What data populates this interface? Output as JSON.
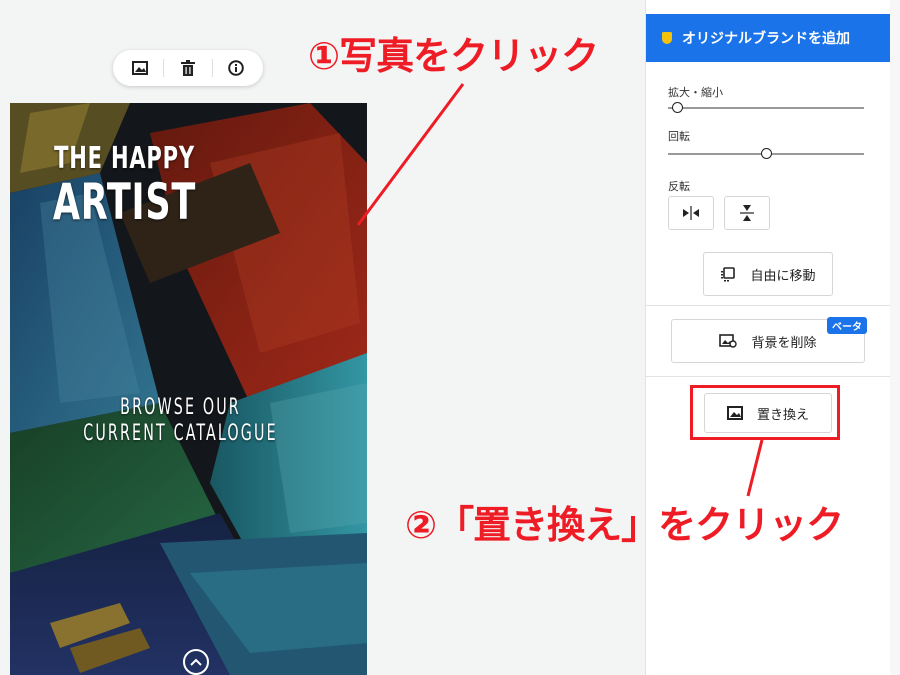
{
  "toolbar": {
    "items": [
      {
        "icon": "image-icon"
      },
      {
        "icon": "trash-icon"
      },
      {
        "icon": "info-icon"
      }
    ]
  },
  "photo": {
    "title_line1": "THE HAPPY",
    "title_line2": "ARTIST",
    "body_line1": "BROWSE OUR",
    "body_line2": "CURRENT CATALOGUE",
    "scroll_icon": "chevron-up-icon"
  },
  "annotations": {
    "step1": "①写真をクリック",
    "step2": "②「置き換え」をクリック",
    "color": "#ee1c25"
  },
  "panel": {
    "brand_button": "オリジナルブランドを追加",
    "zoom_label": "拡大・縮小",
    "zoom_level": 0.02,
    "rotate_label": "回転",
    "rotate_level": 0.5,
    "flip_label": "反転",
    "flip_horizontal_icon": "flip-horizontal-icon",
    "flip_vertical_icon": "flip-vertical-icon",
    "free_move_label": "自由に移動",
    "remove_bg_label": "背景を削除",
    "beta_badge": "ベータ",
    "replace_label": "置き換え",
    "accent": "#1a73e8"
  }
}
